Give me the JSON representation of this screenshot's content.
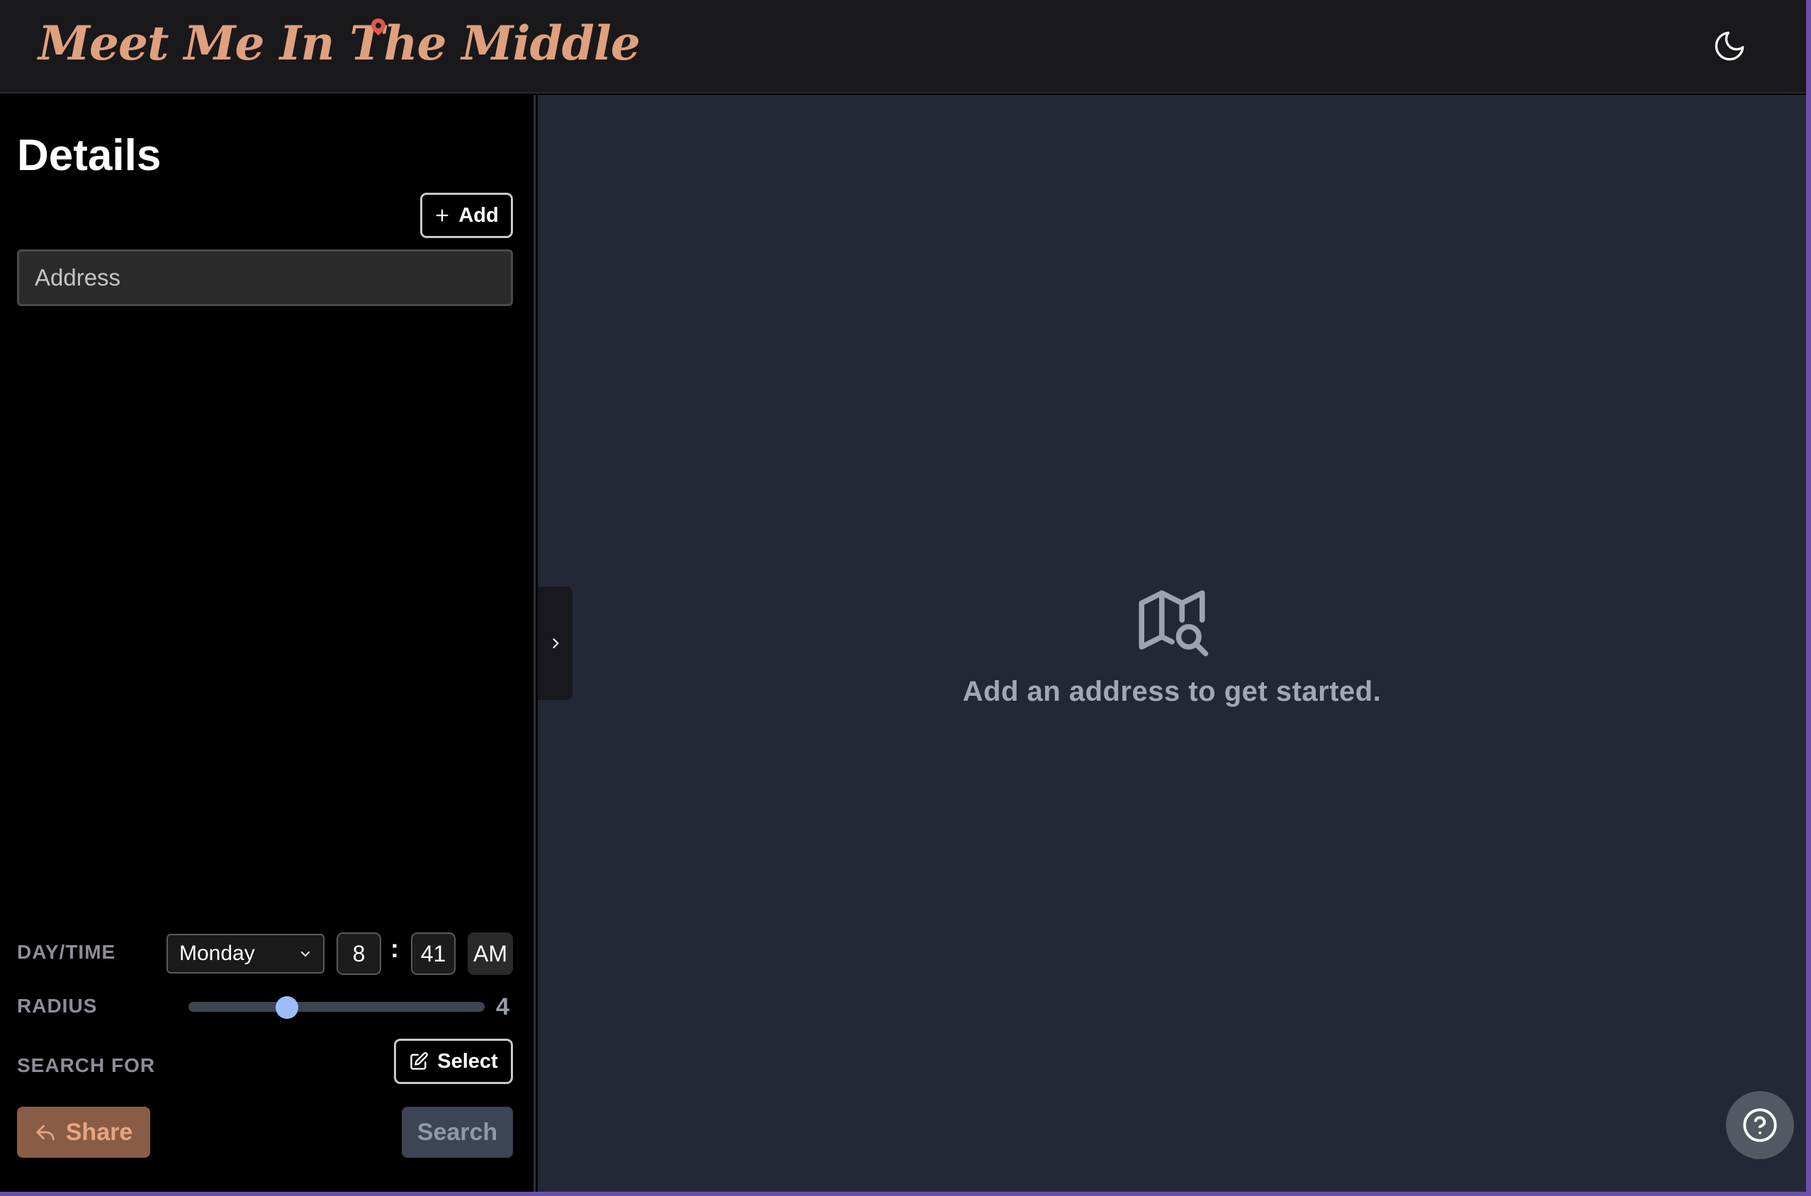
{
  "header": {
    "logo_text": "Meet Me In The Middle",
    "theme_toggle_icon": "moon-icon"
  },
  "sidebar": {
    "title": "Details",
    "add_label": "Add",
    "address_placeholder": "Address",
    "daytime_label": "DAY/TIME",
    "day_value": "Monday",
    "hour_value": "8",
    "time_separator": ":",
    "minute_value": "41",
    "ampm_value": "AM",
    "radius_label": "RADIUS",
    "radius_value": "4",
    "radius_min": 1,
    "radius_max": 10,
    "search_for_label": "SEARCH FOR",
    "select_label": "Select",
    "share_label": "Share",
    "search_label": "Search"
  },
  "main": {
    "empty_icon": "map-search-icon",
    "empty_message": "Add an address to get started.",
    "collapse_icon": "chevron-right-icon",
    "help_icon": "help-circle-icon"
  },
  "colors": {
    "accent": "#e0a07e",
    "pin": "#e0574f",
    "slider_thumb": "#9dbdfa",
    "main_bg": "#222835"
  }
}
